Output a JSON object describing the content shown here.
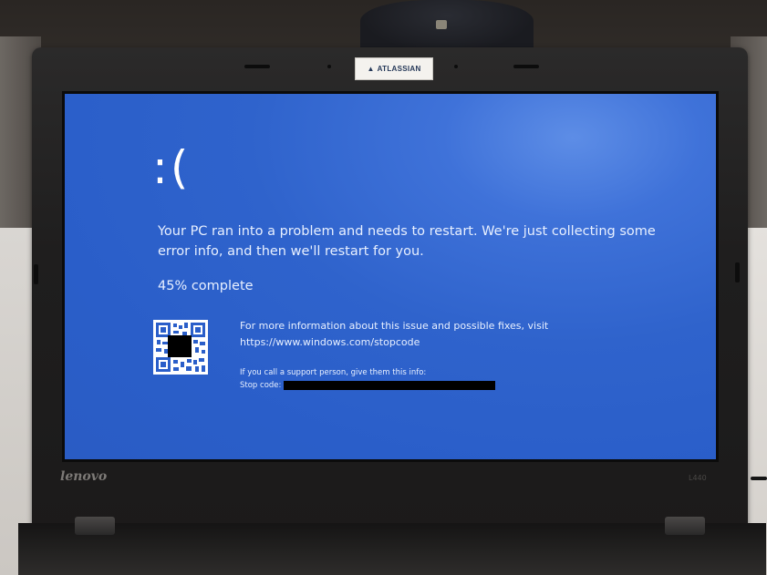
{
  "bsod": {
    "face": ":(",
    "message": "Your PC ran into a problem and needs to restart. We're just collecting some error info, and then we'll restart for you.",
    "progress": "45% complete",
    "progress_value": 0.45,
    "info_line": "For more information about this issue and possible fixes, visit",
    "url": "https://www.windows.com/stopcode",
    "support_line": "If you call a support person, give them this info:",
    "stop_code_label": "Stop code:"
  },
  "laptop": {
    "brand": "lenovo",
    "model": "L440",
    "sticker_text": "ATLASSIAN"
  },
  "colors": {
    "screen_blue": "#2f63cc",
    "bezel": "#1f1e1e",
    "text": "#e8f0ff"
  }
}
